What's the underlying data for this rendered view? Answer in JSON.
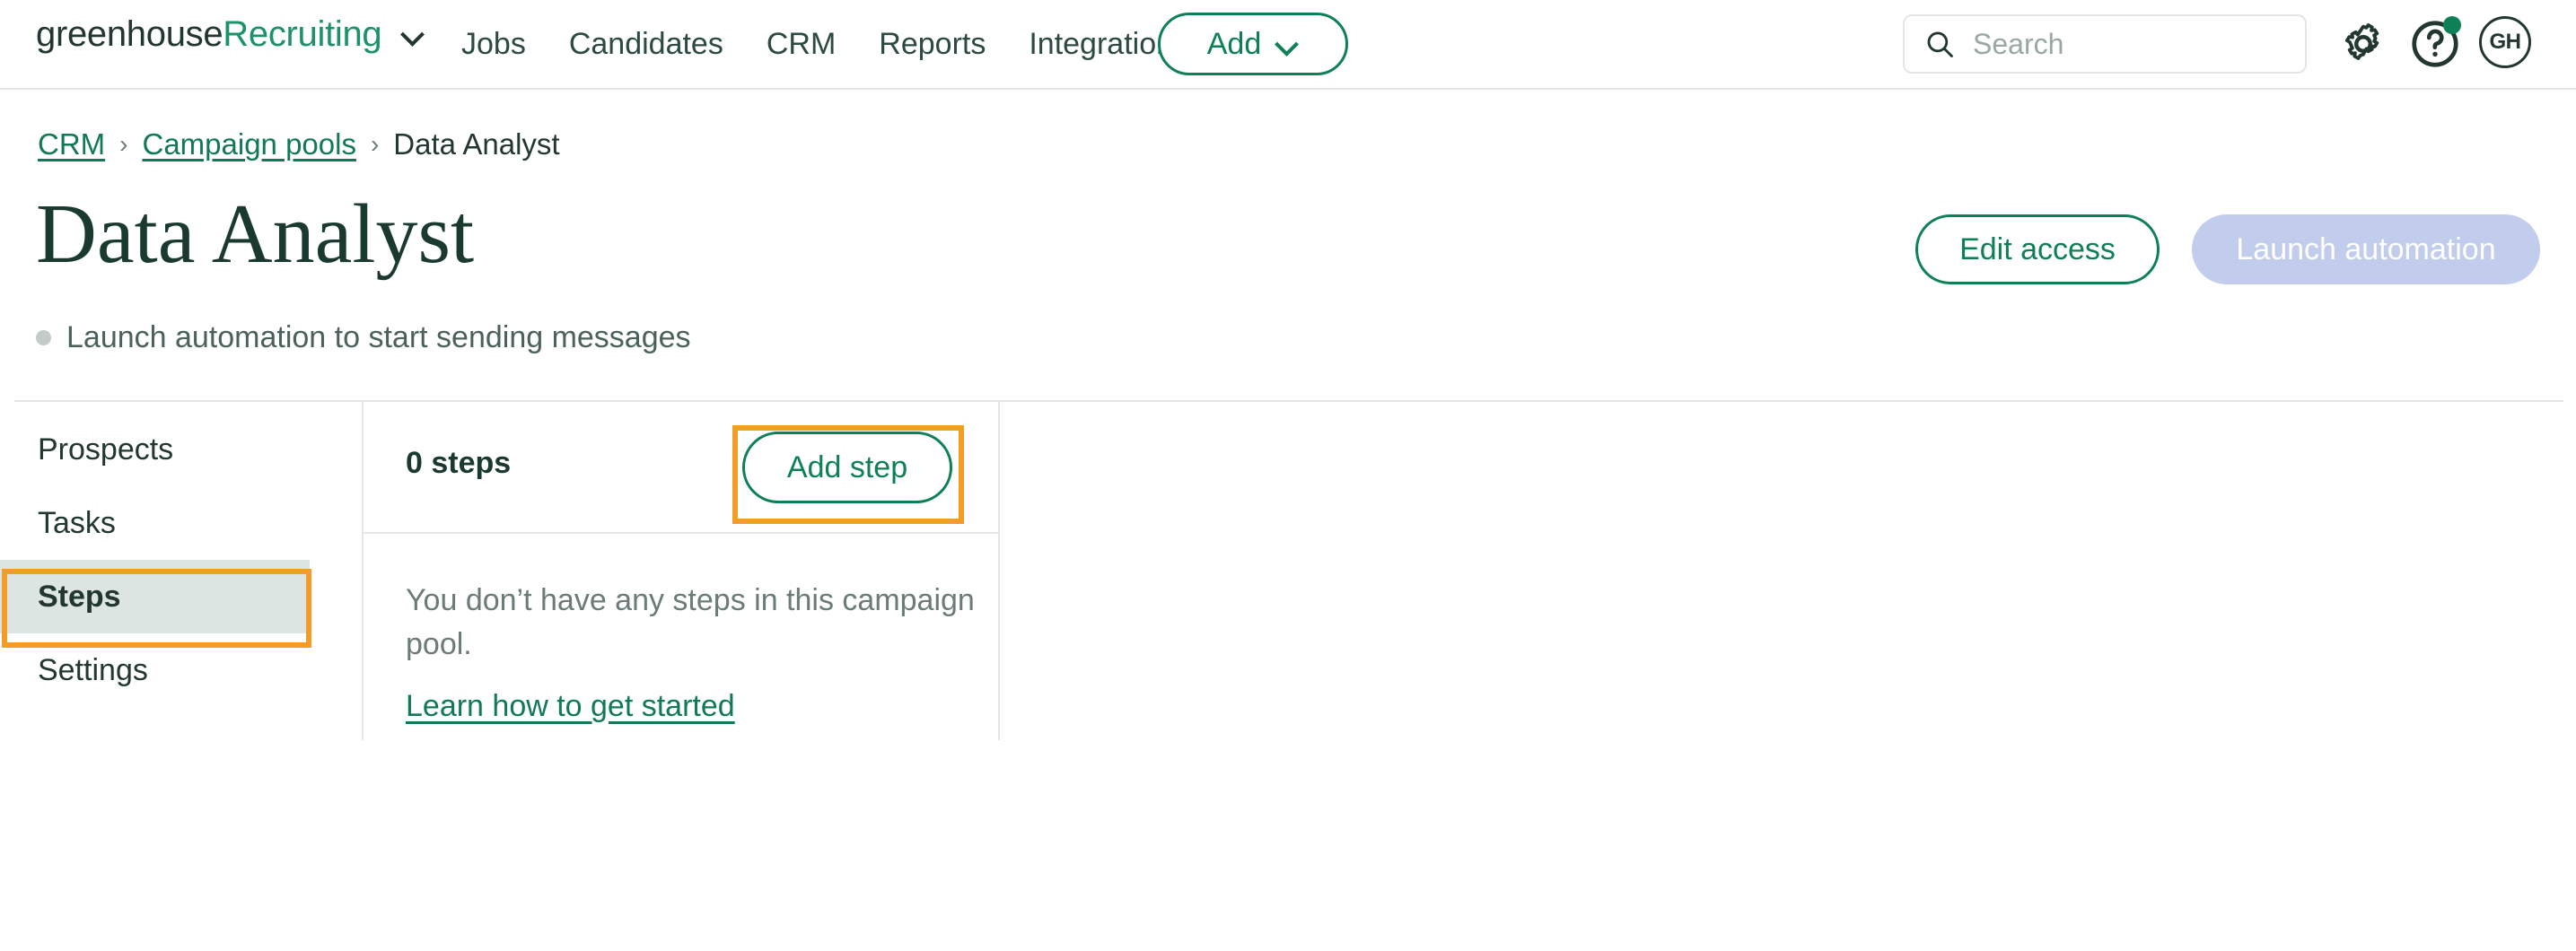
{
  "topnav": {
    "brand": {
      "part1": "greenhouse",
      "part2": "Recruiting",
      "dropdown_icon": "chevron-down-icon"
    },
    "links": [
      {
        "label": "Jobs"
      },
      {
        "label": "Candidates"
      },
      {
        "label": "CRM"
      },
      {
        "label": "Reports"
      },
      {
        "label": "Integrations"
      }
    ],
    "add_button": {
      "label": "Add",
      "icon": "chevron-down-icon"
    },
    "search": {
      "value": "",
      "placeholder": "Search",
      "icon": "search-icon"
    },
    "gear_icon": "gear-icon",
    "help_icon": "help-circle-icon",
    "help_badge": true,
    "avatar": {
      "initials": "GH"
    }
  },
  "breadcrumb": {
    "items": [
      {
        "label": "CRM",
        "link": true
      },
      {
        "label": "Campaign pools",
        "link": true
      },
      {
        "label": "Data Analyst",
        "link": false
      }
    ],
    "separator": "›"
  },
  "header": {
    "title": "Data Analyst",
    "subtitle": "Launch automation to start sending messages",
    "status_dot_color": "#c3ccc9",
    "edit_access_label": "Edit access",
    "launch_automation_label": "Launch automation",
    "launch_automation_disabled": true
  },
  "sidebar": {
    "items": [
      {
        "label": "Prospects",
        "active": false
      },
      {
        "label": "Tasks",
        "active": false
      },
      {
        "label": "Steps",
        "active": true
      },
      {
        "label": "Settings",
        "active": false
      }
    ]
  },
  "steps_panel": {
    "count_label": "0 steps",
    "add_step_label": "Add step",
    "empty_text": "You don’t have any steps in this campaign pool.",
    "empty_link_label": "Learn how to get started"
  },
  "colors": {
    "brand_green": "#1d9268",
    "link_green": "#117a55",
    "outline_green": "#0e8055",
    "dark_green": "#1b3a2e",
    "nav_text": "#2c4a42",
    "muted_text": "#6b7c77",
    "divider": "#e3e8e7",
    "active_bg": "#dde5e2",
    "disabled_button_bg": "#c2cdee",
    "annotation_orange": "#f59c27"
  },
  "annotations": [
    {
      "target": "sidebar-item-steps",
      "color": "#f59c27"
    },
    {
      "target": "add-step-button",
      "color": "#f59c27"
    }
  ]
}
